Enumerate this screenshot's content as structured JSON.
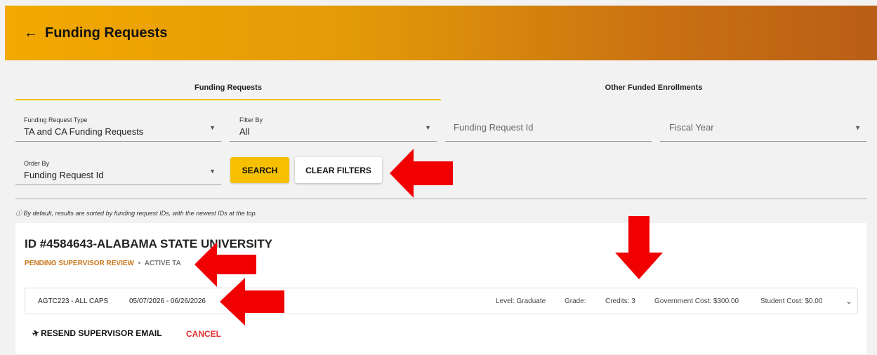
{
  "header": {
    "back_icon": "arrow-left-icon",
    "back_glyph": "←",
    "title": "Funding Requests"
  },
  "tabs": [
    {
      "label": "Funding Requests",
      "active": true
    },
    {
      "label": "Other Funded Enrollments",
      "active": false
    }
  ],
  "filters": {
    "request_type": {
      "label": "Funding Request Type",
      "value": "TA and CA Funding Requests"
    },
    "filter_by": {
      "label": "Filter By",
      "value": "All"
    },
    "request_id": {
      "placeholder": "Funding Request Id"
    },
    "fiscal_year": {
      "placeholder": "Fiscal Year"
    },
    "order_by": {
      "label": "Order By",
      "value": "Funding Request Id"
    },
    "caret_glyph": "▼"
  },
  "buttons": {
    "search": "SEARCH",
    "clear_filters": "CLEAR FILTERS"
  },
  "info_text": "ⓘ By default, results are sorted by funding request IDs, with the newest IDs at the top.",
  "request": {
    "id_title": "ID #4584643-ALABAMA STATE UNIVERSITY",
    "status": "PENDING SUPERVISOR REVIEW",
    "separator": "•",
    "type": "ACTIVE TA",
    "course": {
      "name": "AGTC223 - ALL CAPS",
      "dates": "05/07/2026 - 06/26/2026",
      "level": "Level: Graduate",
      "grade": "Grade:",
      "credits": "Credits: 3",
      "government_cost": "Government Cost: $300.00",
      "student_cost": "Student Cost: $0.00",
      "expand_glyph": "⌄"
    },
    "actions": {
      "resend": "RESEND SUPERVISOR EMAIL",
      "send_icon": "send-icon",
      "send_glyph": "✈",
      "cancel": "CANCEL"
    }
  },
  "colors": {
    "header_start": "#f2a900",
    "header_end": "#b95e16",
    "accent": "#f6c000",
    "status": "#c9761a",
    "cancel": "#e23030",
    "annotation_arrow": "#f00000"
  },
  "annotations": [
    "red-arrow-icon",
    "red-arrow-icon",
    "red-arrow-icon",
    "red-arrow-icon"
  ]
}
